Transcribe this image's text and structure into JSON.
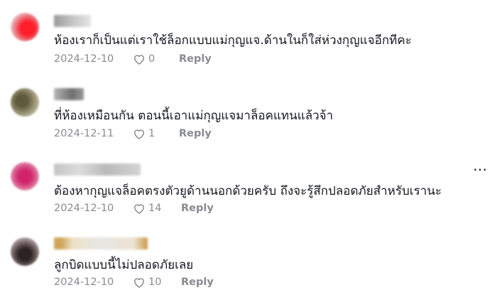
{
  "comments": [
    {
      "username": "",
      "text": "ห้องเราก็เป็นแต่เราใช้ล็อกแบบแม่กุญแจ.ด้านในก็ใส่ห่วงกุญแจอีกทีคะ",
      "date": "2024-12-10",
      "likes": "0",
      "reply_label": "Reply",
      "avatar_color": "#e8232e"
    },
    {
      "username": "",
      "text": "ที่ห้องเหมือนกัน ตอนนี้เอาแม่กุญแจมาล็อคแทนแล้วจ้า",
      "date": "2024-12-11",
      "likes": "1",
      "reply_label": "Reply",
      "avatar_color": "#7d7a5e"
    },
    {
      "username": "",
      "text": "ต้องหากุญแจล็อคตรงตัวยูด้านนอกด้วยครับ ถึงจะรู้สึกปลอดภัยสำหรับเรานะ",
      "date": "2024-12-10",
      "likes": "14",
      "reply_label": "Reply",
      "avatar_color": "#c82a6a"
    },
    {
      "username": "",
      "text": "ลูกบิดแบบนี้ไม่ปลอดภัยเลย",
      "date": "2024-12-10",
      "likes": "10",
      "reply_label": "Reply",
      "avatar_color": "#5a4848"
    }
  ],
  "more_icon": "ellipsis-icon",
  "like_icon": "heart-outline-icon"
}
